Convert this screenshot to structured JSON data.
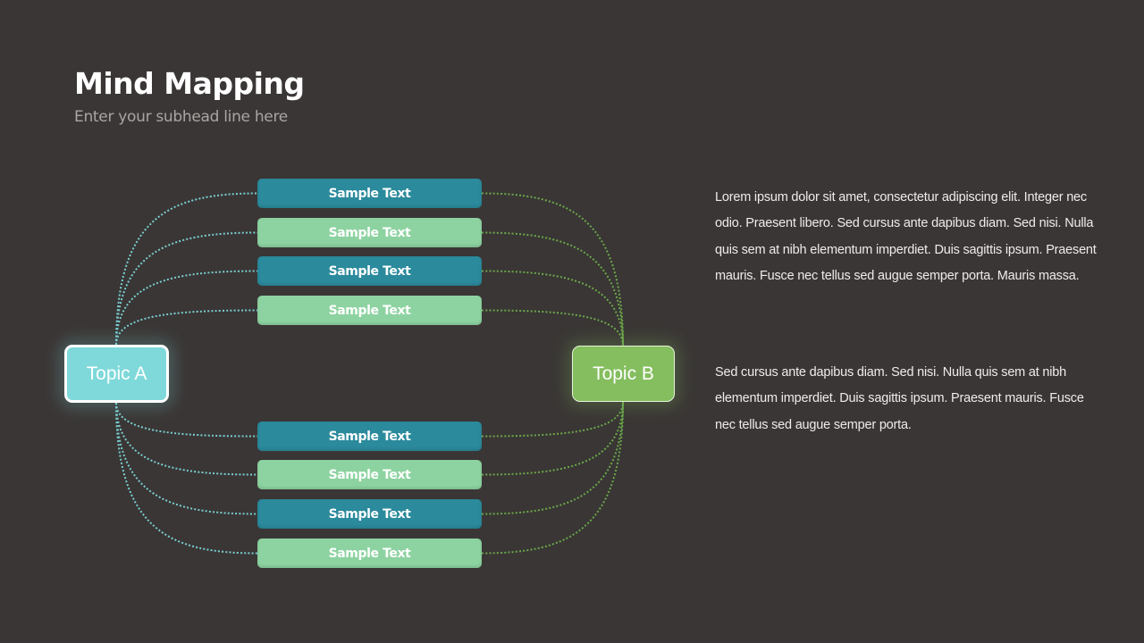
{
  "slide": {
    "title": "Mind Mapping",
    "subtitle": "Enter your subhead line here"
  },
  "topics": {
    "a": {
      "label": "Topic A",
      "color": "#7fd9da",
      "connector_color": "#79cfd0"
    },
    "b": {
      "label": "Topic B",
      "color": "#84be5e",
      "connector_color": "#6aa84a"
    }
  },
  "branches": {
    "top": [
      {
        "label": "Sample Text",
        "style": "teal"
      },
      {
        "label": "Sample Text",
        "style": "mint"
      },
      {
        "label": "Sample Text",
        "style": "teal"
      },
      {
        "label": "Sample Text",
        "style": "mint"
      }
    ],
    "bottom": [
      {
        "label": "Sample Text",
        "style": "teal"
      },
      {
        "label": "Sample Text",
        "style": "mint"
      },
      {
        "label": "Sample Text",
        "style": "teal"
      },
      {
        "label": "Sample Text",
        "style": "mint"
      }
    ]
  },
  "colors": {
    "background": "#3a3635",
    "teal": "#2b8a9c",
    "mint": "#8dd3a1"
  },
  "text_blocks": [
    "Lorem ipsum dolor sit amet, consectetur adipiscing elit. Integer nec odio. Praesent libero. Sed cursus ante dapibus diam. Sed nisi. Nulla quis sem at nibh elementum imperdiet. Duis sagittis ipsum. Praesent mauris. Fusce nec tellus sed augue semper porta. Mauris massa.",
    "Sed cursus ante dapibus diam. Sed nisi. Nulla quis sem at nibh elementum imperdiet. Duis sagittis ipsum. Praesent mauris. Fusce nec tellus sed augue semper porta."
  ]
}
